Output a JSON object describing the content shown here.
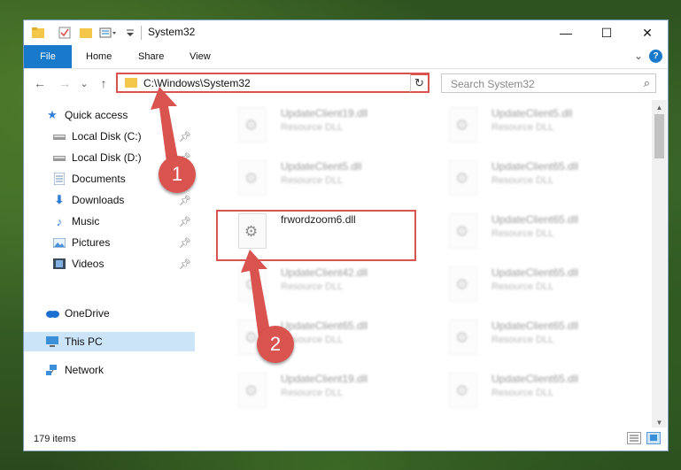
{
  "window": {
    "title": "System32",
    "controls": {
      "minimize": "—",
      "maximize": "☐",
      "close": "✕"
    }
  },
  "ribbon": {
    "file": "File",
    "tabs": [
      "Home",
      "Share",
      "View"
    ],
    "help": "?"
  },
  "navigation": {
    "back": "←",
    "forward": "→",
    "recent": "⌄",
    "up": "↑",
    "address": "C:\\Windows\\System32",
    "search_placeholder": "Search System32"
  },
  "sidebar": {
    "items": [
      {
        "label": "Quick access",
        "icon": "star-icon"
      },
      {
        "label": "Local Disk (C:)",
        "icon": "drive-icon"
      },
      {
        "label": "Local Disk (D:)",
        "icon": "drive-icon"
      },
      {
        "label": "Documents",
        "icon": "documents-icon"
      },
      {
        "label": "Downloads",
        "icon": "download-icon"
      },
      {
        "label": "Music",
        "icon": "music-icon"
      },
      {
        "label": "Pictures",
        "icon": "pictures-icon"
      },
      {
        "label": "Videos",
        "icon": "videos-icon"
      },
      {
        "label": "OneDrive",
        "icon": "cloud-icon"
      },
      {
        "label": "This PC",
        "icon": "computer-icon"
      },
      {
        "label": "Network",
        "icon": "network-icon"
      }
    ]
  },
  "files": {
    "left": [
      {
        "name": "UpdateClient19.dll",
        "type": "Resource DLL"
      },
      {
        "name": "UpdateClient5.dll",
        "type": "Resource DLL"
      },
      {
        "name": "frwordzoom6.dll",
        "type": ""
      },
      {
        "name": "UpdateClient42.dll",
        "type": "Resource DLL"
      },
      {
        "name": "UpdateClient65.dll",
        "type": "Resource DLL"
      },
      {
        "name": "UpdateClient19.dll",
        "type": "Resource DLL"
      }
    ],
    "right": [
      {
        "name": "UpdateClient5.dll",
        "type": "Resource DLL"
      },
      {
        "name": "UpdateClient65.dll",
        "type": "Resource DLL"
      },
      {
        "name": "UpdateClient65.dll",
        "type": "Resource DLL"
      },
      {
        "name": "UpdateClient65.dll",
        "type": "Resource DLL"
      },
      {
        "name": "UpdateClient65.dll",
        "type": "Resource DLL"
      },
      {
        "name": "UpdateClient65.dll",
        "type": "Resource DLL"
      }
    ]
  },
  "status": {
    "count": "179 items"
  },
  "callouts": {
    "one": "1",
    "two": "2"
  },
  "colors": {
    "accent": "#1979ca",
    "highlight": "#d9534f"
  }
}
